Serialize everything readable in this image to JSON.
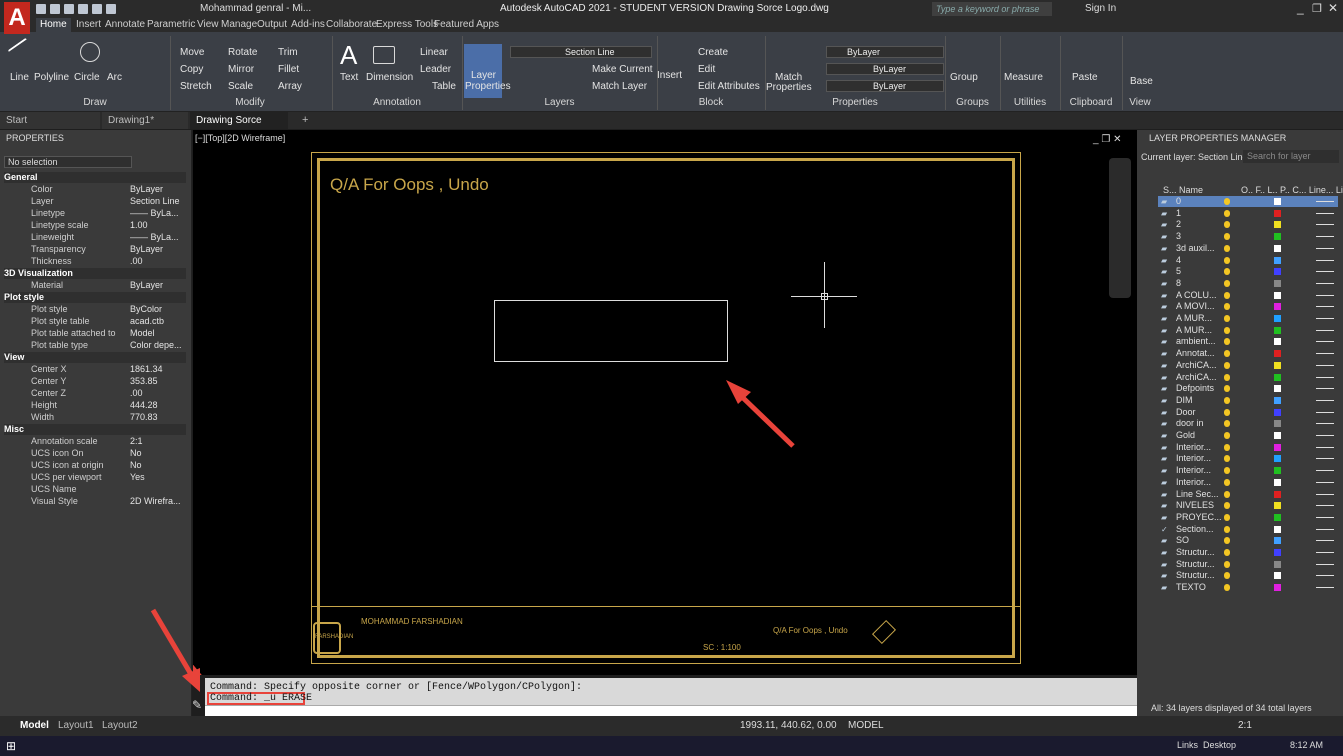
{
  "title": {
    "qa_user": "Mohammad genral - Mi...",
    "app_title": "Autodesk AutoCAD 2021 - STUDENT VERSION   Drawing Sorce Logo.dwg",
    "search_placeholder": "Type a keyword or phrase",
    "sign_in": "Sign In"
  },
  "tabs": [
    "Home",
    "Insert",
    "Annotate",
    "Parametric",
    "View",
    "Manage",
    "Output",
    "Add-ins",
    "Collaborate",
    "Express Tools",
    "Featured Apps"
  ],
  "ribbon": {
    "draw": {
      "title": "Draw",
      "line": "Line",
      "polyline": "Polyline",
      "circle": "Circle",
      "arc": "Arc"
    },
    "modify": {
      "title": "Modify",
      "move": "Move",
      "rotate": "Rotate",
      "trim": "Trim",
      "copy": "Copy",
      "mirror": "Mirror",
      "fillet": "Fillet",
      "stretch": "Stretch",
      "scale": "Scale",
      "array": "Array"
    },
    "annotation": {
      "title": "Annotation",
      "text": "Text",
      "dimension": "Dimension",
      "linear": "Linear",
      "leader": "Leader",
      "table": "Table"
    },
    "layers": {
      "title": "Layers",
      "layer_properties_1": "Layer",
      "layer_properties_2": "Properties",
      "current": "Section Line",
      "make_current": "Make Current",
      "match_layer": "Match Layer"
    },
    "block": {
      "title": "Block",
      "insert": "Insert",
      "create": "Create",
      "edit": "Edit",
      "edit_attributes": "Edit Attributes"
    },
    "properties": {
      "title": "Properties",
      "match_1": "Match",
      "match_2": "Properties",
      "bylayer": "ByLayer",
      "bylayer2": "ByLayer",
      "bylayer3": "ByLayer"
    },
    "groups": {
      "title": "Groups",
      "group": "Group"
    },
    "utilities": {
      "title": "Utilities",
      "measure": "Measure"
    },
    "clipboard": {
      "title": "Clipboard",
      "paste": "Paste"
    },
    "view": {
      "title": "View",
      "base": "Base"
    }
  },
  "doctabs": {
    "start": "Start",
    "drawing1": "Drawing1*",
    "current": "Drawing Sorce Logo*"
  },
  "properties": {
    "header": "PROPERTIES",
    "selection": "No selection",
    "general": "General",
    "d3": "3D Visualization",
    "plot": "Plot style",
    "view": "View",
    "misc": "Misc",
    "rows_general": [
      [
        "Color",
        "ByLayer"
      ],
      [
        "Layer",
        "Section Line"
      ],
      [
        "Linetype",
        "—— ByLa..."
      ],
      [
        "Linetype scale",
        "1.00"
      ],
      [
        "Lineweight",
        "—— ByLa..."
      ],
      [
        "Transparency",
        "ByLayer"
      ],
      [
        "Thickness",
        ".00"
      ]
    ],
    "rows_3d": [
      [
        "Material",
        "ByLayer"
      ]
    ],
    "rows_plot": [
      [
        "Plot style",
        "ByColor"
      ],
      [
        "Plot style table",
        "acad.ctb"
      ],
      [
        "Plot table attached to",
        "Model"
      ],
      [
        "Plot table type",
        "Color depe..."
      ]
    ],
    "rows_view": [
      [
        "Center X",
        "1861.34"
      ],
      [
        "Center Y",
        "353.85"
      ],
      [
        "Center Z",
        ".00"
      ],
      [
        "Height",
        "444.28"
      ],
      [
        "Width",
        "770.83"
      ]
    ],
    "rows_misc": [
      [
        "Annotation scale",
        "2:1"
      ],
      [
        "UCS icon On",
        "No"
      ],
      [
        "UCS icon at origin",
        "No"
      ],
      [
        "UCS per viewport",
        "Yes"
      ],
      [
        "UCS Name",
        ""
      ],
      [
        "Visual Style",
        "2D Wirefra..."
      ]
    ]
  },
  "viewport": {
    "label": "[−][Top][2D Wireframe]",
    "heading": "Q/A For  Oops , Undo",
    "tb_name": "MOHAMMAD FARSHADIAN",
    "tb_logo": "FARSHADIAN",
    "tb_scale": "SC : 1:100",
    "tb_title": "Q/A For Oops , Undo"
  },
  "layer_manager": {
    "header": "LAYER PROPERTIES MANAGER",
    "current": "Current layer: Section Line",
    "search": "Search for layer",
    "col_status": "S...",
    "col_name": "Name",
    "col_rest": "O.. F.. L.. P.. C... Line... Line",
    "footer": "All: 34 layers displayed of 34 total layers",
    "layers": [
      "0",
      "1",
      "2",
      "3",
      "3d auxil...",
      "4",
      "5",
      "8",
      "A COLU...",
      "A MOVI...",
      "A MUR...",
      "A MUR...",
      "ambient...",
      "Annotat...",
      "ArchiCA...",
      "ArchiCA...",
      "Defpoints",
      "DIM",
      "Door",
      "door in",
      "Gold",
      "Interior...",
      "Interior...",
      "Interior...",
      "Interior...",
      "Line Sec...",
      "NIVELES",
      "PROYEC...",
      "Section...",
      "SO",
      "Structur...",
      "Structur...",
      "Structur...",
      "TEXTO"
    ]
  },
  "command": {
    "line1": "Command: Specify opposite corner or [Fence/WPolygon/CPolygon]:",
    "line2": "Command: _u ERASE"
  },
  "status": {
    "model_tab": "Model",
    "layout1": "Layout1",
    "layout2": "Layout2",
    "coords": "1993.11, 440.62, 0.00",
    "model": "MODEL",
    "scale": "2:1"
  },
  "taskbar": {
    "links": "Links",
    "desktop": "Desktop",
    "time": "8:12 AM"
  },
  "colors": {
    "accent_red": "#e8433a",
    "gold": "#c8a64a",
    "canvas": "#000000"
  }
}
